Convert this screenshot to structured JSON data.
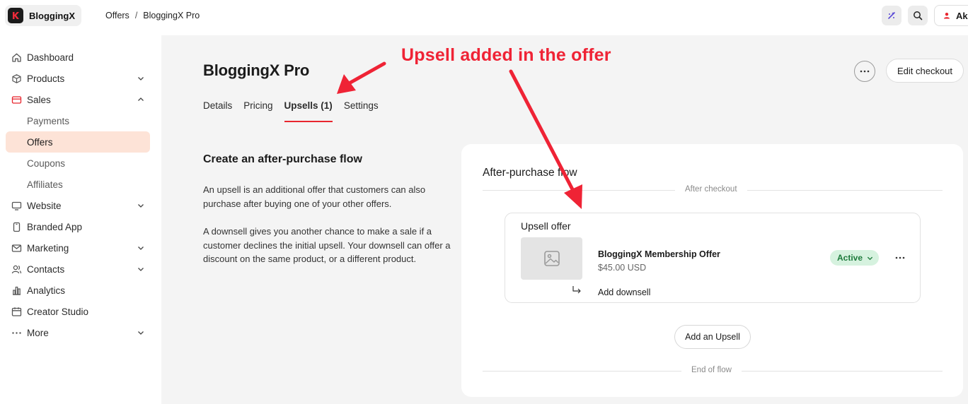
{
  "topbar": {
    "brand": "BloggingX",
    "breadcrumb": [
      "Offers",
      "BloggingX Pro"
    ],
    "separator": "/",
    "user_initials": "Ak"
  },
  "sidebar": {
    "items": [
      {
        "label": "Dashboard",
        "icon": "home-icon"
      },
      {
        "label": "Products",
        "icon": "box-icon",
        "chevron": "down"
      },
      {
        "label": "Sales",
        "icon": "credit-card-icon",
        "chevron": "up"
      },
      {
        "label": "Payments",
        "sub": true
      },
      {
        "label": "Offers",
        "sub": true,
        "active": true
      },
      {
        "label": "Coupons",
        "sub": true
      },
      {
        "label": "Affiliates",
        "sub": true
      },
      {
        "label": "Website",
        "icon": "monitor-icon",
        "chevron": "down"
      },
      {
        "label": "Branded App",
        "icon": "phone-icon"
      },
      {
        "label": "Marketing",
        "icon": "mail-icon",
        "chevron": "down"
      },
      {
        "label": "Contacts",
        "icon": "users-icon",
        "chevron": "down"
      },
      {
        "label": "Analytics",
        "icon": "bar-chart-icon"
      },
      {
        "label": "Creator Studio",
        "icon": "calendar-icon"
      },
      {
        "label": "More",
        "icon": "ellipsis-icon",
        "chevron": "down"
      }
    ]
  },
  "main": {
    "title": "BloggingX Pro",
    "tabs": [
      "Details",
      "Pricing",
      "Upsells (1)",
      "Settings"
    ],
    "active_tab": "Upsells (1)",
    "edit_checkout_label": "Edit checkout",
    "section_heading": "Create an after-purchase flow",
    "desc_upsell": "An upsell is an additional offer that customers can also purchase after buying one of your other offers.",
    "desc_downsell": "A downsell gives you another chance to make a sale if a customer declines the initial upsell. Your downsell can offer a discount on the same product, or a different product."
  },
  "flow_card": {
    "title": "After-purchase flow",
    "start_label": "After checkout",
    "end_label": "End of flow",
    "upsell": {
      "heading": "Upsell offer",
      "offer_name": "BloggingX Membership Offer",
      "price": "$45.00 USD",
      "status": "Active",
      "add_downsell_label": "Add downsell"
    },
    "add_upsell_label": "Add an Upsell"
  },
  "annotation": {
    "text": "Upsell added in the offer",
    "color": "#ef2335"
  },
  "colors": {
    "accent": "#e8262e",
    "active_nav_bg": "#fde3d7",
    "status_bg": "#d6f2df",
    "status_text": "#1e7b3c"
  }
}
